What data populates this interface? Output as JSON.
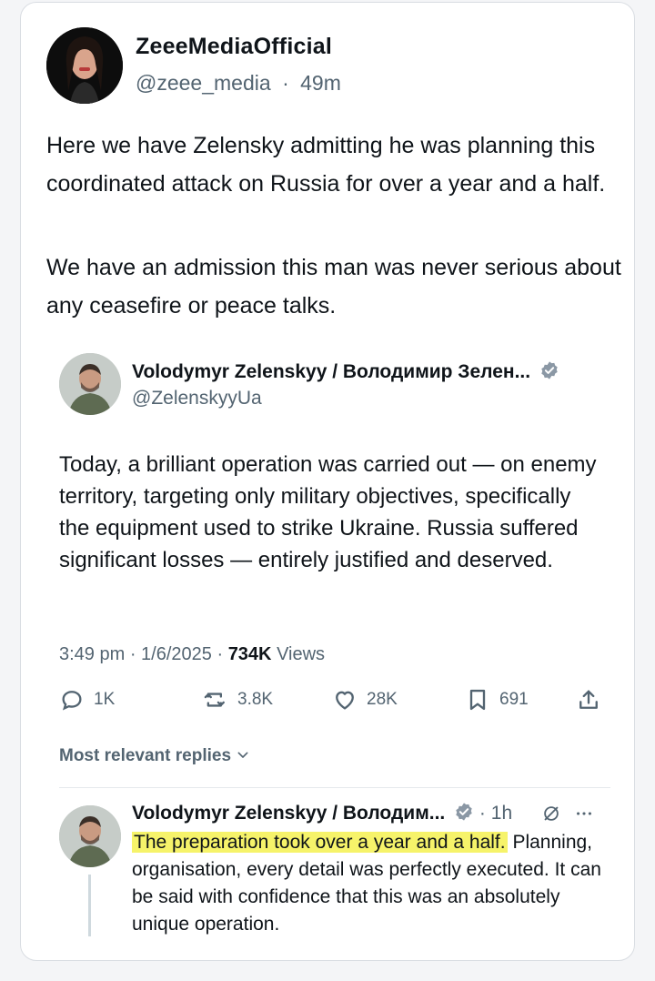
{
  "outer_tweet": {
    "display_name": "ZeeeMediaOfficial",
    "handle": "@zeee_media",
    "separator": "·",
    "time": "49m",
    "paragraphs": [
      "Here we have Zelensky admitting he was planning this coordinated attack on Russia for over a year and a half.",
      "We have an admission this man was never serious about any ceasefire or peace talks."
    ]
  },
  "quoted_tweet": {
    "display_name": "Volodymyr Zelenskyy / Володимир Зелен...",
    "handle": "@ZelenskyyUa",
    "text": "Today, a brilliant operation was carried out — on enemy territory, targeting only military objectives, specifically the equipment used to strike Ukraine. Russia suffered significant losses — entirely justified and deserved.",
    "time": "3:49 pm",
    "date": "1/6/2025",
    "views_count": "734K",
    "views_label": "Views",
    "actions": {
      "replies": "1K",
      "reposts": "3.8K",
      "likes": "28K",
      "bookmarks": "691"
    },
    "replies_sort_label": "Most relevant replies"
  },
  "reply": {
    "display_name": "Volodymyr Zelenskyy / Володим...",
    "time": "1h",
    "highlighted_text": "The preparation took over a year and a half.",
    "text": "Planning, organisation, every detail was perfectly executed. It can be said with confidence that this was an absolutely unique operation."
  },
  "colors": {
    "verified": "#1d9bf0",
    "highlight": "#f6f36a",
    "secondary_text": "#536471"
  }
}
